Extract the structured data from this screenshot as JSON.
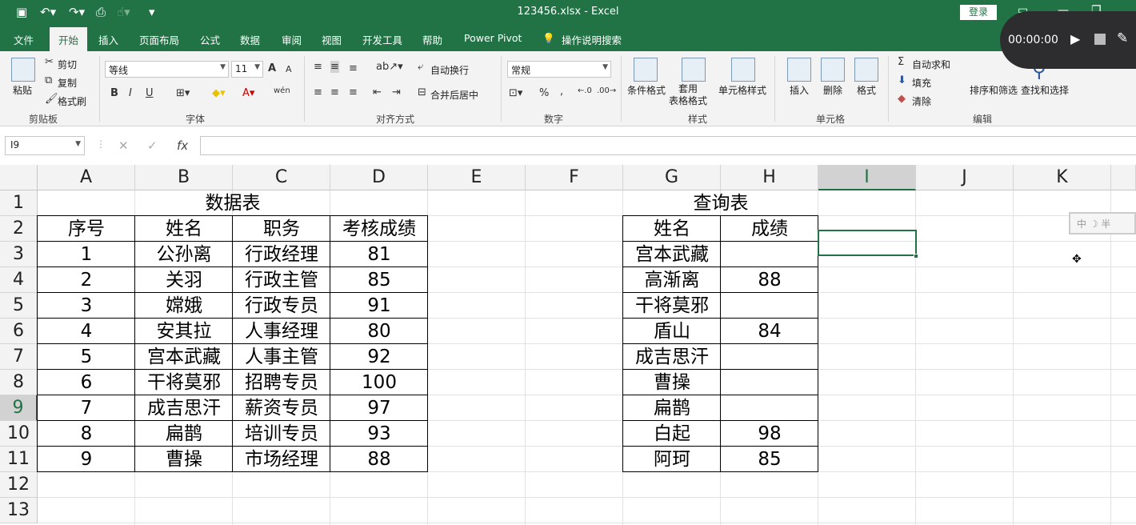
{
  "title_bar": {
    "file_title": "123456.xlsx  -  Excel",
    "login_label": "登录"
  },
  "tabs": [
    "文件",
    "开始",
    "插入",
    "页面布局",
    "公式",
    "数据",
    "审阅",
    "视图",
    "开发工具",
    "帮助",
    "Power Pivot",
    "操作说明搜索"
  ],
  "ribbon": {
    "clipboard": {
      "paste": "粘贴",
      "cut": "剪切",
      "copy": "复制",
      "format_painter": "格式刷",
      "group": "剪贴板"
    },
    "font": {
      "name": "等线",
      "size": "11",
      "group": "字体",
      "bold": "B",
      "italic": "I",
      "underline": "U",
      "grow": "A",
      "shrink": "A",
      "phonetic": "wén"
    },
    "alignment": {
      "wrap": "自动换行",
      "merge": "合并后居中",
      "group": "对齐方式"
    },
    "number": {
      "format": "常规",
      "percent": "%",
      "comma": ",",
      "group": "数字"
    },
    "styles": {
      "conditional": "条件格式",
      "table": "套用\n表格格式",
      "cell_styles": "单元格样式",
      "group": "样式"
    },
    "cells": {
      "insert": "插入",
      "delete": "删除",
      "format": "格式",
      "group": "单元格"
    },
    "editing": {
      "autosum": "自动求和",
      "fill": "填充",
      "clear": "清除",
      "sort": "排序和筛选",
      "find": "查找和选择",
      "group": "编辑"
    }
  },
  "recorder": {
    "time": "00:00:00"
  },
  "formula_bar": {
    "name_box": "I9",
    "formula": "",
    "fx": "fx"
  },
  "columns": [
    "A",
    "B",
    "C",
    "D",
    "E",
    "F",
    "G",
    "H",
    "I",
    "J",
    "K"
  ],
  "rows": [
    "1",
    "2",
    "3",
    "4",
    "5",
    "6",
    "7",
    "8",
    "9",
    "10",
    "11",
    "12",
    "13"
  ],
  "selected_cell": {
    "column": "I",
    "row": "9"
  },
  "data_table": {
    "title": "数据表",
    "headers": [
      "序号",
      "姓名",
      "职务",
      "考核成绩"
    ],
    "rows": [
      [
        "1",
        "公孙离",
        "行政经理",
        "81"
      ],
      [
        "2",
        "关羽",
        "行政主管",
        "85"
      ],
      [
        "3",
        "嫦娥",
        "行政专员",
        "91"
      ],
      [
        "4",
        "安其拉",
        "人事经理",
        "80"
      ],
      [
        "5",
        "宫本武藏",
        "人事主管",
        "92"
      ],
      [
        "6",
        "干将莫邪",
        "招聘专员",
        "100"
      ],
      [
        "7",
        "成吉思汗",
        "薪资专员",
        "97"
      ],
      [
        "8",
        "扁鹊",
        "培训专员",
        "93"
      ],
      [
        "9",
        "曹操",
        "市场经理",
        "88"
      ]
    ]
  },
  "query_table": {
    "title": "查询表",
    "headers": [
      "姓名",
      "成绩"
    ],
    "rows": [
      [
        "宫本武藏",
        ""
      ],
      [
        "高渐离",
        "88"
      ],
      [
        "干将莫邪",
        ""
      ],
      [
        "盾山",
        "84"
      ],
      [
        "成吉思汗",
        ""
      ],
      [
        "曹操",
        ""
      ],
      [
        "扁鹊",
        ""
      ],
      [
        "白起",
        "98"
      ],
      [
        "阿珂",
        "85"
      ]
    ]
  },
  "ime": {
    "text": "中 ☽ 半"
  },
  "colors": {
    "accent": "#217346",
    "header_bg": "#f3f3f3"
  }
}
